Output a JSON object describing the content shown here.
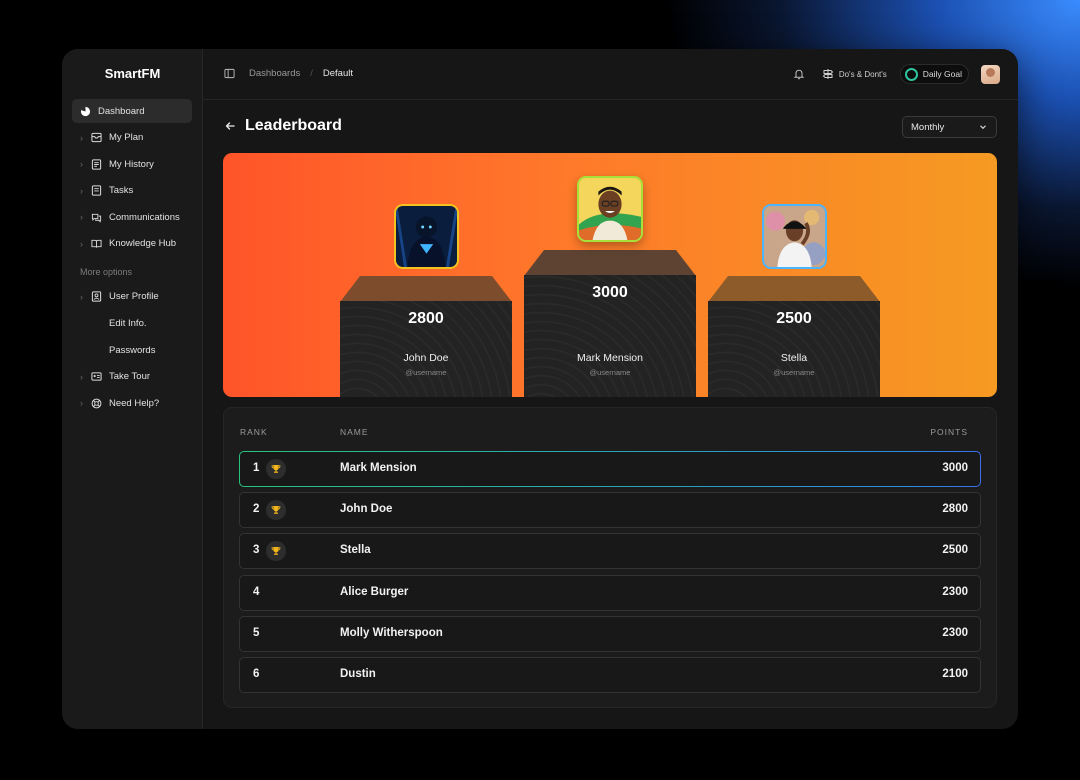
{
  "app": {
    "brand": "SmartFM"
  },
  "sidebar": {
    "items": [
      {
        "label": "Dashboard"
      },
      {
        "label": "My Plan"
      },
      {
        "label": "My History"
      },
      {
        "label": "Tasks"
      },
      {
        "label": "Communications"
      },
      {
        "label": "Knowledge Hub"
      }
    ],
    "more_label": "More options",
    "more_items": [
      {
        "label": "User Profile"
      },
      {
        "label": "Edit Info."
      },
      {
        "label": "Passwords"
      },
      {
        "label": "Take Tour"
      },
      {
        "label": "Need Help?"
      }
    ]
  },
  "header": {
    "breadcrumb": [
      "Dashboards",
      "Default"
    ],
    "dos_label": "Do's & Dont's",
    "goal_label": "Daily Goal"
  },
  "page": {
    "title": "Leaderboard",
    "period": "Monthly"
  },
  "podium": {
    "first": {
      "name": "Mark Mension",
      "score": "3000",
      "user": "@username"
    },
    "second": {
      "name": "John Doe",
      "score": "2800",
      "user": "@username"
    },
    "third": {
      "name": "Stella",
      "score": "2500",
      "user": "@username"
    }
  },
  "table": {
    "headers": {
      "rank": "RANK",
      "name": "NAME",
      "points": "POINTS"
    },
    "rows": [
      {
        "rank": "1",
        "name": "Mark Mension",
        "points": "3000",
        "trophy": true
      },
      {
        "rank": "2",
        "name": "John Doe",
        "points": "2800",
        "trophy": true
      },
      {
        "rank": "3",
        "name": "Stella",
        "points": "2500",
        "trophy": true
      },
      {
        "rank": "4",
        "name": "Alice Burger",
        "points": "2300",
        "trophy": false
      },
      {
        "rank": "5",
        "name": "Molly Witherspoon",
        "points": "2300",
        "trophy": false
      },
      {
        "rank": "6",
        "name": "Dustin",
        "points": "2100",
        "trophy": false
      }
    ]
  },
  "colors": {
    "banner_start": "#ff5429",
    "banner_end": "#f59a22",
    "goal_ring": "#2fc3a0",
    "trophy": "#f2b51c"
  }
}
